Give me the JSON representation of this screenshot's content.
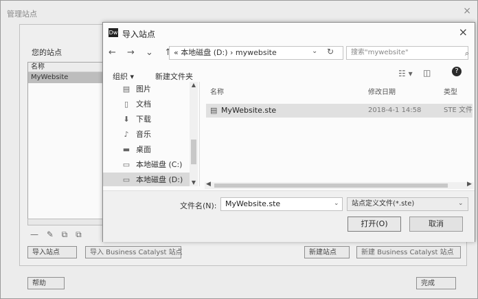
{
  "outer": {
    "title": "管理站点",
    "close": "×",
    "sites_label": "您的站点",
    "list_header": "名称",
    "sites": [
      "MyWebsite"
    ],
    "tools": "— ✎ ⧉ ⧉",
    "buttons": {
      "import_site": "导入站点",
      "import_bc": "导入 Business Catalyst 站点",
      "new_site": "新建站点",
      "new_bc": "新建 Business Catalyst 站点",
      "help": "帮助",
      "done": "完成"
    }
  },
  "dialog": {
    "logo": "Dw",
    "title": "导入站点",
    "close": "×",
    "nav": "← → ⌄ ↑",
    "address": "« 本地磁盘 (D:) › mywebsite",
    "address_drop": "⌄",
    "refresh": "↻",
    "search_placeholder": "搜索\"mywebsite\"",
    "search_icon": "⌕",
    "organize": "组织 ▾",
    "new_folder": "新建文件夹",
    "view": "☷ ▾",
    "pane": "◫",
    "help": "?",
    "tree": [
      {
        "icon": "▤",
        "label": "图片",
        "icon_name": "pictures-icon"
      },
      {
        "icon": "▯",
        "label": "文档",
        "icon_name": "documents-icon"
      },
      {
        "icon": "⬇",
        "label": "下载",
        "icon_name": "downloads-icon"
      },
      {
        "icon": "♪",
        "label": "音乐",
        "icon_name": "music-icon"
      },
      {
        "icon": "▬",
        "label": "桌面",
        "icon_name": "desktop-icon"
      },
      {
        "icon": "▭",
        "label": "本地磁盘 (C:)",
        "icon_name": "drive-c-icon"
      },
      {
        "icon": "▭",
        "label": "本地磁盘 (D:)",
        "icon_name": "drive-d-icon"
      }
    ],
    "columns": {
      "name": "名称",
      "date": "修改日期",
      "type": "类型"
    },
    "file": {
      "name": "MyWebsite.ste",
      "date": "2018-4-1 14:58",
      "type": "STE 文件"
    },
    "filename_label": "文件名(N):",
    "filename_value": "MyWebsite.ste",
    "filetype": "站点定义文件(*.ste)",
    "open": "打开(O)",
    "cancel": "取消"
  }
}
